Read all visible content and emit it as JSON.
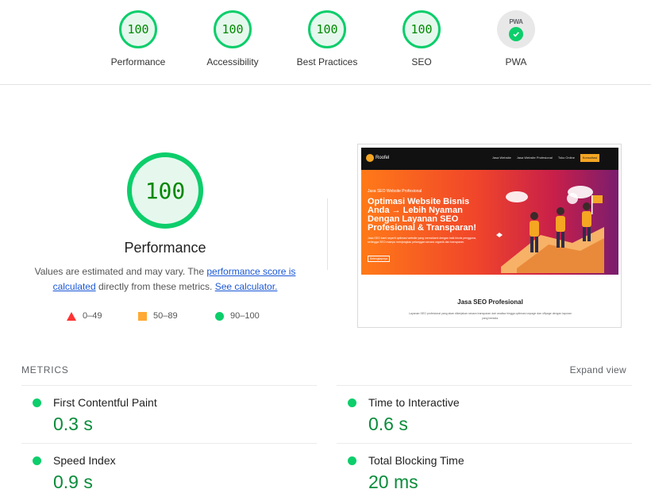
{
  "summary": {
    "gauges": [
      {
        "score": "100",
        "label": "Performance"
      },
      {
        "score": "100",
        "label": "Accessibility"
      },
      {
        "score": "100",
        "label": "Best Practices"
      },
      {
        "score": "100",
        "label": "SEO"
      }
    ],
    "pwa": {
      "badge": "PWA",
      "label": "PWA"
    }
  },
  "performance": {
    "score": "100",
    "title": "Performance",
    "desc_prefix": "Values are estimated and may vary. The ",
    "desc_link1": "performance score is calculated",
    "desc_middle": " directly from these metrics. ",
    "desc_link2": "See calculator."
  },
  "legend": {
    "fail": "0–49",
    "average": "50–89",
    "pass": "90–100"
  },
  "screenshot": {
    "logo": "Roofel",
    "nav": [
      "Jasa Website",
      "Jasa Website Profesional",
      "Toko Online",
      "Jasa SEO"
    ],
    "nav_button": "Konsultasi",
    "tag": "Jasa SEO Website Profesional",
    "hero_title": "Optimasi Website Bisnis Anda → Lebih Nyaman Dengan Layanan SEO Profesional & Transparan!",
    "hero_body": "Jasa SEO kami seperti optimasi website yang memahami dengan baik bisnis pengguna, sehingga SEO mampu menjangkau pelanggan secara organik dan transparan.",
    "hero_button": "Selengkapnya",
    "section_title": "Jasa SEO Profesional",
    "section_body": "Layanan SEO profesional yang akan dikerjakan secara transparan dari analisa hingga optimasi onpage dan offpage dengan laporan yang berkala."
  },
  "metrics": {
    "title": "METRICS",
    "expand": "Expand view",
    "items": [
      {
        "name": "First Contentful Paint",
        "value": "0.3 s"
      },
      {
        "name": "Time to Interactive",
        "value": "0.6 s"
      },
      {
        "name": "Speed Index",
        "value": "0.9 s"
      },
      {
        "name": "Total Blocking Time",
        "value": "20 ms"
      }
    ]
  },
  "colors": {
    "pass": "#0cce6b",
    "pass_text": "#008800",
    "average": "#ffaa33",
    "fail": "#ff3333",
    "link": "#1a57d6"
  }
}
